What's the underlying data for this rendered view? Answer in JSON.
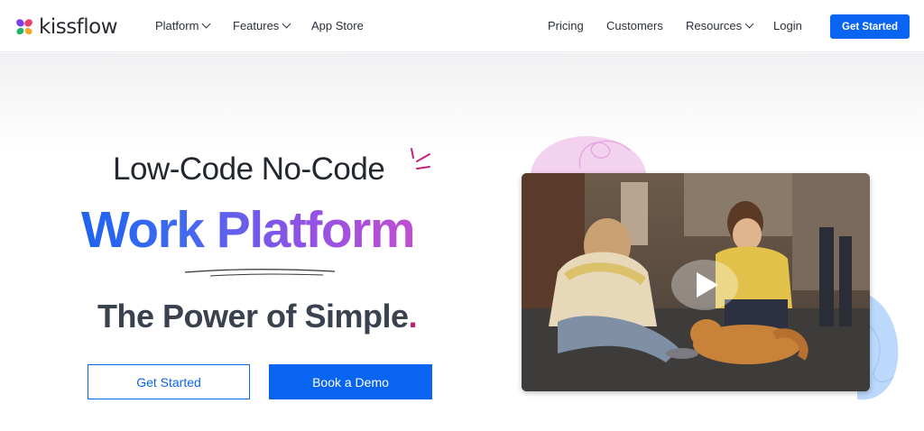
{
  "brand": {
    "name": "kissflow",
    "colors": {
      "primary": "#0a64f2",
      "gradient_start": "#1e63f0",
      "gradient_end": "#c04fd3",
      "accent_dot": "#c0217a"
    }
  },
  "nav": {
    "left_items": [
      {
        "label": "Platform",
        "has_dropdown": true
      },
      {
        "label": "Features",
        "has_dropdown": true
      },
      {
        "label": "App Store",
        "has_dropdown": false
      }
    ],
    "right_items": [
      {
        "label": "Pricing",
        "has_dropdown": false
      },
      {
        "label": "Customers",
        "has_dropdown": false
      },
      {
        "label": "Resources",
        "has_dropdown": true
      },
      {
        "label": "Login",
        "has_dropdown": false
      }
    ],
    "cta_label": "Get Started"
  },
  "hero": {
    "headline_small": "Low-Code No-Code",
    "headline_large": "Work Platform",
    "tagline": "The Power of Simple",
    "tagline_dot": ".",
    "primary_button": "Get Started",
    "secondary_button": "Book a Demo"
  },
  "video": {
    "icon": "play-icon"
  }
}
